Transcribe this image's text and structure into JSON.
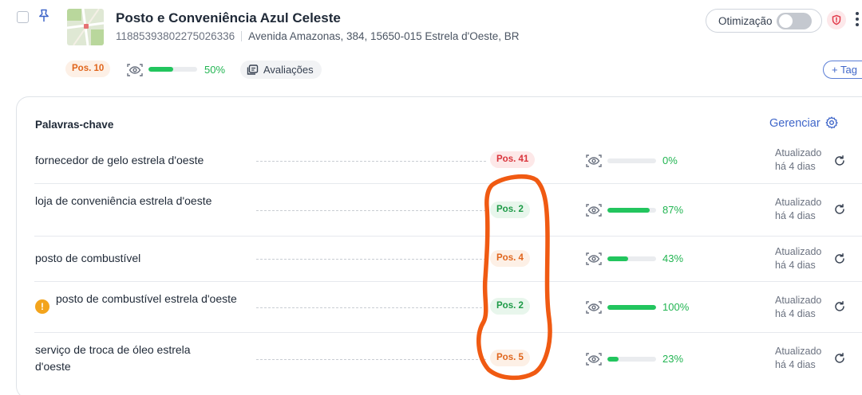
{
  "listing": {
    "title": "Posto e Conveniência Azul Celeste",
    "id": "11885393802275026336",
    "address": "Avenida Amazonas, 384, 15650-015 Estrela d'Oeste, BR",
    "position_label": "Pos. 10",
    "visibility_percent": 50,
    "visibility_label": "50%",
    "reviews_label": "Avaliações",
    "tag_button_label": "+ Tag"
  },
  "header": {
    "optimization_label": "Otimização",
    "optimization_enabled": false
  },
  "keywords_card": {
    "title": "Palavras-chave",
    "manage_label": "Gerenciar",
    "rows": [
      {
        "keyword": "fornecedor de gelo estrela d'oeste",
        "position": "Pos. 41",
        "position_color": "red",
        "visibility_percent": 0,
        "visibility_label": "0%",
        "updated_line1": "Atualizado",
        "updated_line2": "há 4 dias",
        "warning": false
      },
      {
        "keyword": "loja de conveniência estrela d'oeste",
        "position": "Pos. 2",
        "position_color": "green",
        "visibility_percent": 87,
        "visibility_label": "87%",
        "updated_line1": "Atualizado",
        "updated_line2": "há 4 dias",
        "warning": false
      },
      {
        "keyword": "posto de combustível",
        "position": "Pos. 4",
        "position_color": "orange",
        "visibility_percent": 43,
        "visibility_label": "43%",
        "updated_line1": "Atualizado",
        "updated_line2": "há 4 dias",
        "warning": false
      },
      {
        "keyword": "posto de combustível estrela d'oeste",
        "position": "Pos. 2",
        "position_color": "green",
        "visibility_percent": 100,
        "visibility_label": "100%",
        "updated_line1": "Atualizado",
        "updated_line2": "há 4 dias",
        "warning": true,
        "warning_symbol": "!"
      },
      {
        "keyword": "serviço de troca de óleo estrela d'oeste",
        "position": "Pos. 5",
        "position_color": "orange",
        "visibility_percent": 23,
        "visibility_label": "23%",
        "updated_line1": "Atualizado",
        "updated_line2": "há 4 dias",
        "warning": false
      }
    ]
  },
  "colors": {
    "accent_blue": "#3f66c9",
    "success_green": "#22c55e",
    "annotation_orange": "#f05a12"
  },
  "icons": {
    "pin": "pin-icon",
    "eye": "eye-icon",
    "reviews": "reviews-icon",
    "settings": "gear-icon",
    "refresh": "refresh-icon",
    "shield": "shield-icon",
    "more": "kebab-menu-icon"
  }
}
